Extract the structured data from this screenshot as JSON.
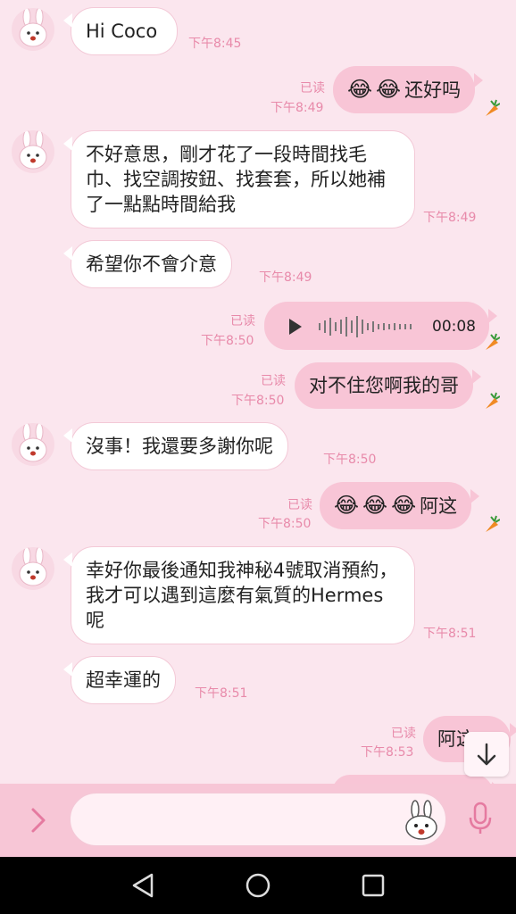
{
  "messages": [
    {
      "dir": "in",
      "text": "Hi Coco",
      "time": "下午8:45"
    },
    {
      "dir": "out",
      "emojis": [
        "😂",
        "😂"
      ],
      "text": "还好吗",
      "read": "已读",
      "time": "下午8:49"
    },
    {
      "dir": "in",
      "text": "不好意思，剛才花了一段時間找毛巾、找空調按鈕、找套套，所以她補了一點點時間給我",
      "time": "下午8:49"
    },
    {
      "dir": "in",
      "text": "希望你不會介意",
      "time": "下午8:49"
    },
    {
      "dir": "out",
      "type": "voice",
      "duration": "00:08",
      "read": "已读",
      "time": "下午8:50"
    },
    {
      "dir": "out",
      "text": "对不住您啊我的哥",
      "read": "已读",
      "time": "下午8:50"
    },
    {
      "dir": "in",
      "text": "沒事！我還要多謝你呢",
      "time": "下午8:50"
    },
    {
      "dir": "out",
      "emojis": [
        "😂",
        "😂",
        "😂"
      ],
      "text": "阿这",
      "read": "已读",
      "time": "下午8:50"
    },
    {
      "dir": "in",
      "text": "幸好你最後通知我神秘4號取消預約，我才可以遇到這麼有氣質的Hermes呢",
      "time": "下午8:51"
    },
    {
      "dir": "in",
      "text": "超幸運的",
      "time": "下午8:51"
    },
    {
      "dir": "out",
      "text": "阿这",
      "read": "已读",
      "time": "下午8:53"
    }
  ],
  "icons": {
    "contact_avatar": "bunny-avatar-icon",
    "carrot": "carrot-icon",
    "scroll_down": "arrow-down-icon",
    "expand": "chevron-right-icon",
    "sticker": "bunny-sticker-icon",
    "mic": "microphone-icon",
    "nav_back": "triangle-back-icon",
    "nav_home": "circle-home-icon",
    "nav_recents": "square-recents-icon"
  },
  "colors": {
    "background": "#fbe6ee",
    "outgoing_bubble": "#f8c5d6",
    "incoming_bubble": "#ffffff",
    "timestamp": "#e88aaa",
    "composer": "#f7c6d6"
  }
}
